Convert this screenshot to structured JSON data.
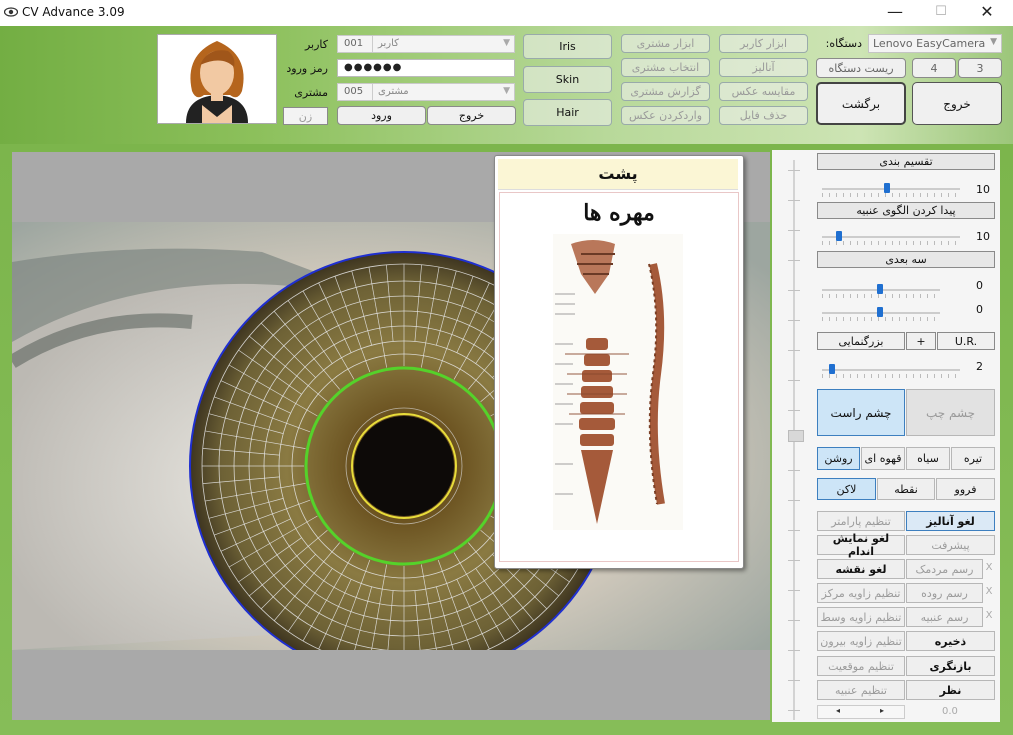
{
  "window": {
    "title": "CV Advance 3.09",
    "controls": {
      "minimize": "—",
      "maximize": "☐",
      "close": "✕"
    }
  },
  "header": {
    "user_label": "کاربر",
    "password_label": "رمز ورود",
    "customer_label": "مشتری",
    "user_combo": {
      "code": "001",
      "text": "کاربر"
    },
    "password_value": "●●●●●●",
    "customer_combo": {
      "code": "005",
      "text": "مشتری"
    },
    "gender": "زن",
    "login": "ورود",
    "logout": "خروج",
    "mode_buttons": [
      "Iris",
      "Skin",
      "Hair"
    ],
    "tools": {
      "customer_tools": "ابزار مشتری",
      "user_tools": "ابزار کاربر",
      "select_customer": "انتخاب مشتری",
      "analyze": "آنالیز",
      "customer_report": "گزارش مشتری",
      "compare_photo": "مقایسه عکس",
      "import_photo": "واردکردن عکس",
      "delete_file": "حذف فایل"
    },
    "device_label": ":دستگاه",
    "device_value": "Lenovo EasyCamera",
    "reset_device": "ریست دستگاه",
    "num_4": "4",
    "num_3": "3",
    "back": "برگشت",
    "exit": "خروج"
  },
  "popup": {
    "title": "پشت",
    "subtitle": "مهره ها"
  },
  "panel": {
    "segmentation": {
      "label": "تقسیم بندی",
      "value": "10",
      "level": 10
    },
    "lens_pattern": {
      "label": "پیدا کردن الگوی عنبیه",
      "value": "10",
      "level": 10
    },
    "three_d": {
      "label": "سه بعدی",
      "value1": "0",
      "value2": "0"
    },
    "ur": "U.R.",
    "plus": "+",
    "zoom": {
      "label": "بزرگنمایی",
      "value": "2"
    },
    "left_eye": "چشم چپ",
    "right_eye": "چشم راست",
    "shades": [
      "تیره",
      "سیاه",
      "قهوه ای",
      "روشن"
    ],
    "shade_selected": "روشن",
    "marks": [
      "فروو",
      "نقطه",
      "لاکن"
    ],
    "mark_selected": "لاکن",
    "actions": {
      "cancel_analysis": "لغو آنالیز",
      "set_params": "تنظیم پارامتر",
      "advanced": "پیشرفت",
      "cancel_organs": "لغو نمایش اندام",
      "draw_pupil": "رسم مردمک",
      "cancel_map": "لغو نقشه",
      "draw_intestine": "رسم روده",
      "set_center_angle": "تنظیم زاویه مرکز",
      "draw_iris": "رسم عنبیه",
      "set_mid_angle": "تنظیم زاویه وسط",
      "save": "ذخیره",
      "set_out_angle": "تنظیم زاویه بیرون",
      "restore": "بازنگری",
      "set_position": "تنظیم موقعیت",
      "comment": "نظر",
      "set_iris": "تنظیم عنبیه"
    },
    "x_marks": [
      "X",
      "X",
      "X"
    ],
    "coord": "0.0"
  },
  "colors": {
    "accent": "#3d7fbf",
    "slider_knob": "#1f6fd0",
    "iris_outer_ring": "#1f2fd0",
    "iris_mid_ring": "#55d22a",
    "pupil_ring": "#e8dc3a",
    "header_green": "#8cc05b"
  }
}
